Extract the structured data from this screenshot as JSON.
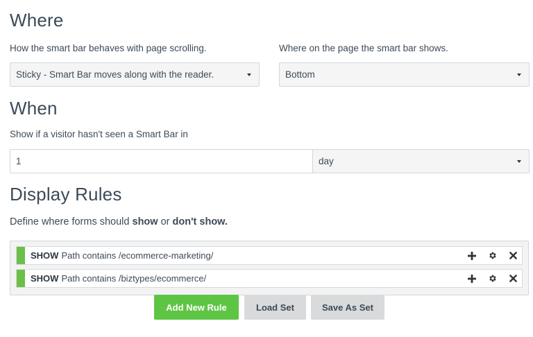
{
  "where": {
    "heading": "Where",
    "scroll_label": "How the smart bar behaves with page scrolling.",
    "scroll_value": "Sticky - Smart Bar moves along with the reader.",
    "position_label": "Where on the page the smart bar shows.",
    "position_value": "Bottom"
  },
  "when": {
    "heading": "When",
    "label": "Show if a visitor hasn't seen a Smart Bar in",
    "amount_value": "1",
    "unit_value": "day"
  },
  "display_rules": {
    "heading": "Display Rules",
    "desc_prefix": "Define where forms should ",
    "desc_show": "show",
    "desc_mid": " or ",
    "desc_dont": "don't show.",
    "rules": [
      {
        "keyword": "SHOW",
        "text": "Path contains /ecommerce-marketing/"
      },
      {
        "keyword": "SHOW",
        "text": "Path contains /biztypes/ecommerce/"
      }
    ],
    "accent_color": "#6cc04a"
  },
  "buttons": {
    "add_rule": "Add New Rule",
    "load_set": "Load Set",
    "save_as_set": "Save As Set"
  }
}
